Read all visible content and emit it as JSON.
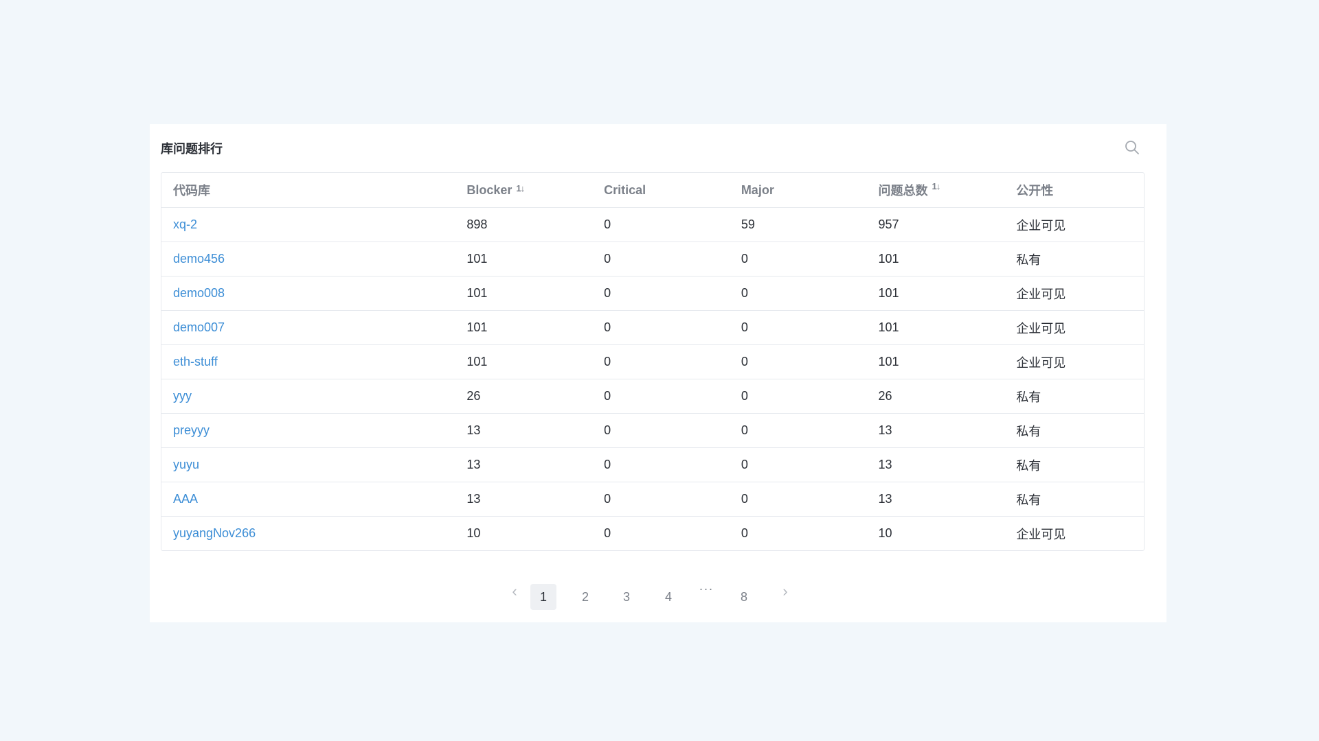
{
  "panel": {
    "title": "库问题排行",
    "search_icon": "search-icon"
  },
  "table": {
    "columns": [
      "代码库",
      "Blocker",
      "Critical",
      "Major",
      "问题总数",
      "公开性"
    ],
    "sort_glyph": "1↓",
    "rows": [
      {
        "repo": "xq-2",
        "blocker": "898",
        "critical": "0",
        "major": "59",
        "total": "957",
        "visibility": "企业可见"
      },
      {
        "repo": "demo456",
        "blocker": "101",
        "critical": "0",
        "major": "0",
        "total": "101",
        "visibility": "私有"
      },
      {
        "repo": "demo008",
        "blocker": "101",
        "critical": "0",
        "major": "0",
        "total": "101",
        "visibility": "企业可见"
      },
      {
        "repo": "demo007",
        "blocker": "101",
        "critical": "0",
        "major": "0",
        "total": "101",
        "visibility": "企业可见"
      },
      {
        "repo": "eth-stuff",
        "blocker": "101",
        "critical": "0",
        "major": "0",
        "total": "101",
        "visibility": "企业可见"
      },
      {
        "repo": "yyy",
        "blocker": "26",
        "critical": "0",
        "major": "0",
        "total": "26",
        "visibility": "私有"
      },
      {
        "repo": "preyyy",
        "blocker": "13",
        "critical": "0",
        "major": "0",
        "total": "13",
        "visibility": "私有"
      },
      {
        "repo": "yuyu",
        "blocker": "13",
        "critical": "0",
        "major": "0",
        "total": "13",
        "visibility": "私有"
      },
      {
        "repo": "AAA",
        "blocker": "13",
        "critical": "0",
        "major": "0",
        "total": "13",
        "visibility": "私有"
      },
      {
        "repo": "yuyangNov266",
        "blocker": "10",
        "critical": "0",
        "major": "0",
        "total": "10",
        "visibility": "企业可见"
      }
    ]
  },
  "pagination": {
    "prev": "‹",
    "pages": [
      "1",
      "2",
      "3",
      "4"
    ],
    "ellipsis": "···",
    "last": "8",
    "next": "›",
    "current": "1"
  },
  "colors": {
    "link": "#3d8ed6",
    "background": "#f2f7fb",
    "text": "#2b2f36",
    "header_text": "#7b8089"
  }
}
